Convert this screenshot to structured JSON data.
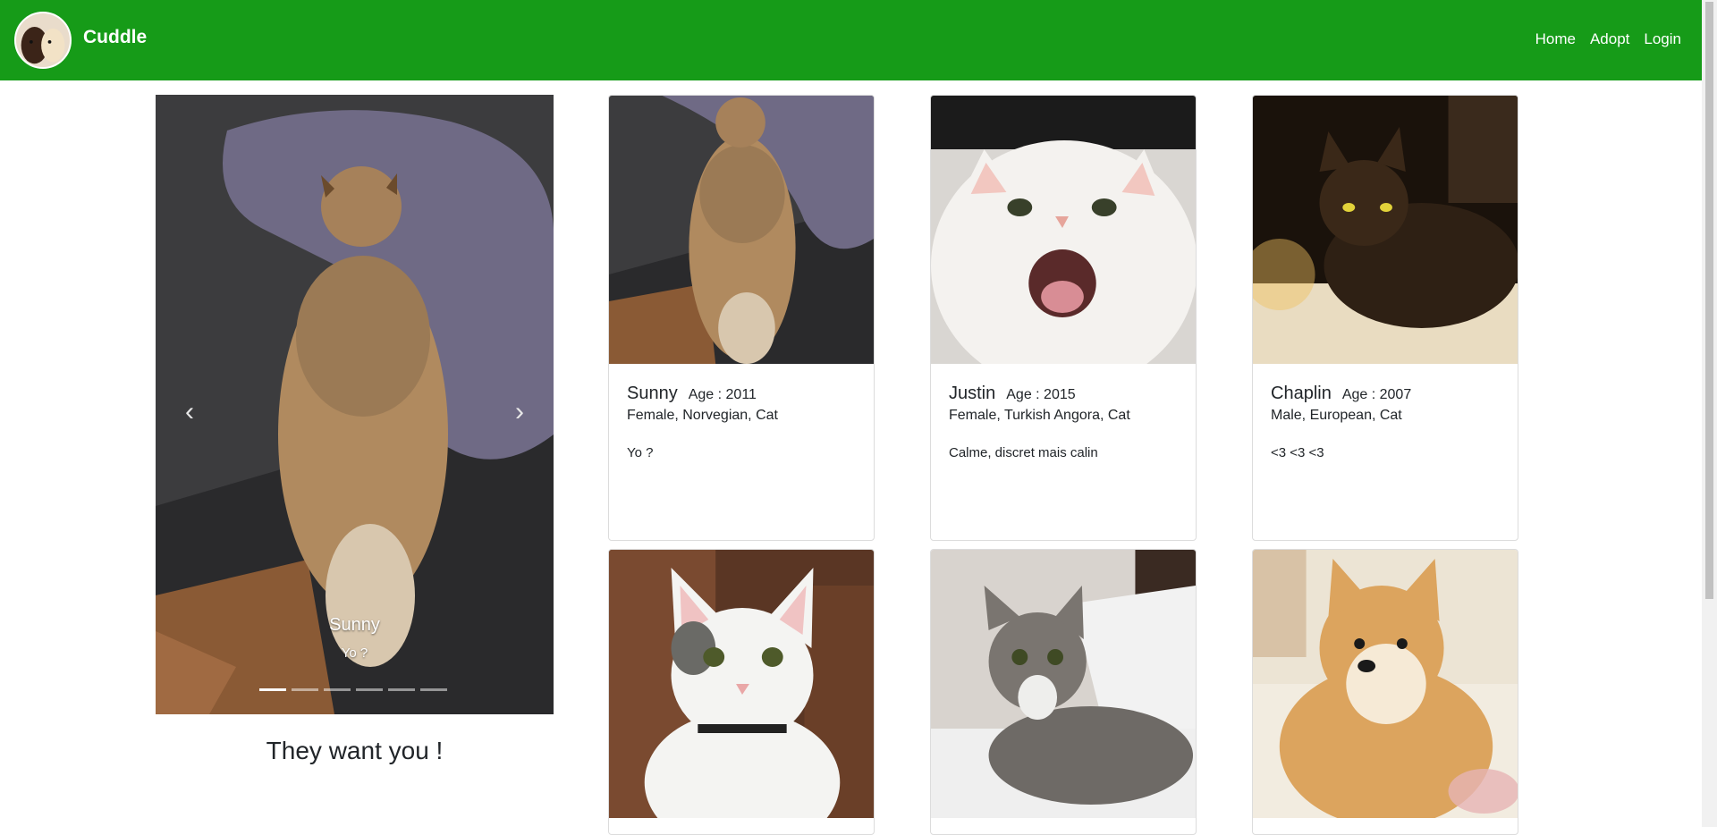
{
  "navbar": {
    "brand": "Cuddle",
    "links": [
      "Home",
      "Adopt",
      "Login"
    ],
    "color": "#169b18"
  },
  "carousel": {
    "caption_name": "Sunny",
    "caption_desc": "Yo ?",
    "prev_icon": "chevron-left",
    "next_icon": "chevron-right",
    "slides": 6,
    "active_slide": 1
  },
  "tagline": "They want you !",
  "cards": [
    {
      "name": "Sunny",
      "age_label": "Age : 2011",
      "info": "Female, Norvegian, Cat",
      "desc": "Yo ?"
    },
    {
      "name": "Justin",
      "age_label": "Age : 2015",
      "info": "Female, Turkish Angora, Cat",
      "desc": "Calme, discret mais calin"
    },
    {
      "name": "Chaplin",
      "age_label": "Age : 2007",
      "info": "Male, European, Cat",
      "desc": "<3 <3 <3"
    },
    {
      "name": "",
      "age_label": "",
      "info": "",
      "desc": ""
    },
    {
      "name": "",
      "age_label": "",
      "info": "",
      "desc": ""
    },
    {
      "name": "",
      "age_label": "",
      "info": "",
      "desc": ""
    }
  ]
}
